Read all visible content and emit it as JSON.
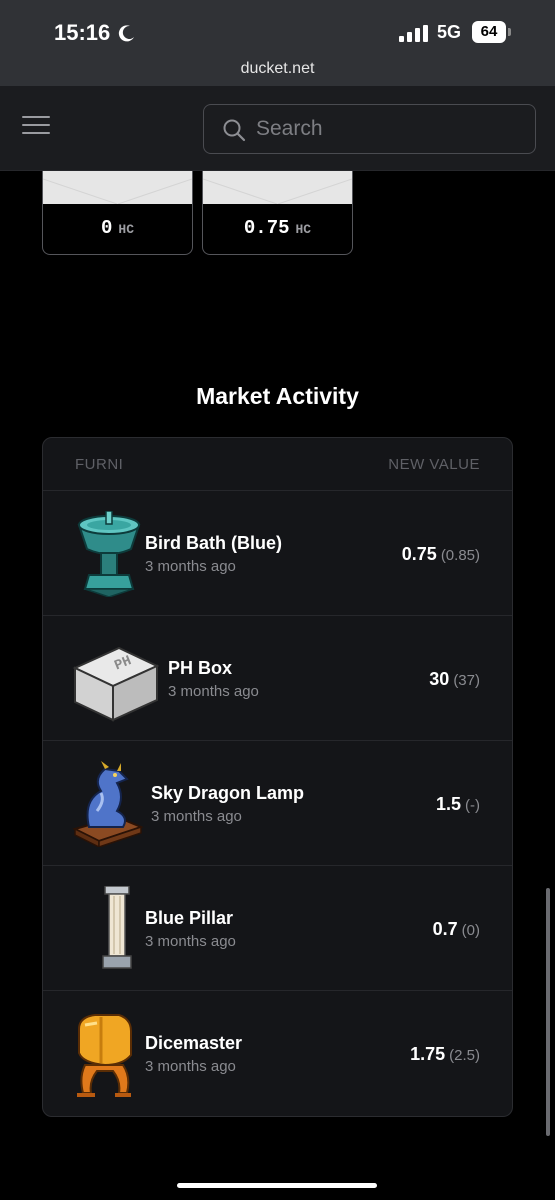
{
  "status_bar": {
    "time": "15:16",
    "network": "5G",
    "battery": "64"
  },
  "browser": {
    "url": "ducket.net"
  },
  "header": {
    "search_placeholder": "Search"
  },
  "value_cards": [
    {
      "value": "0",
      "unit": "HC"
    },
    {
      "value": "0.75",
      "unit": "HC"
    }
  ],
  "market": {
    "title": "Market Activity",
    "col_furni": "FURNI",
    "col_value": "NEW VALUE",
    "rows": [
      {
        "name": "Bird Bath (Blue)",
        "time": "3 months ago",
        "value": "0.75",
        "old": "(0.85)",
        "icon": "bird-bath-icon"
      },
      {
        "name": "PH Box",
        "time": "3 months ago",
        "value": "30",
        "old": "(37)",
        "icon": "ph-box-icon"
      },
      {
        "name": "Sky Dragon Lamp",
        "time": "3 months ago",
        "value": "1.5",
        "old": "(-)",
        "icon": "dragon-lamp-icon"
      },
      {
        "name": "Blue Pillar",
        "time": "3 months ago",
        "value": "0.7",
        "old": "(0)",
        "icon": "pillar-icon"
      },
      {
        "name": "Dicemaster",
        "time": "3 months ago",
        "value": "1.75",
        "old": "(2.5)",
        "icon": "dicemaster-icon"
      }
    ]
  },
  "colors": {
    "page_bg": "#000000",
    "panel_bg": "#141518",
    "header_bg": "#1b1c1f",
    "muted": "#8a8b90"
  }
}
